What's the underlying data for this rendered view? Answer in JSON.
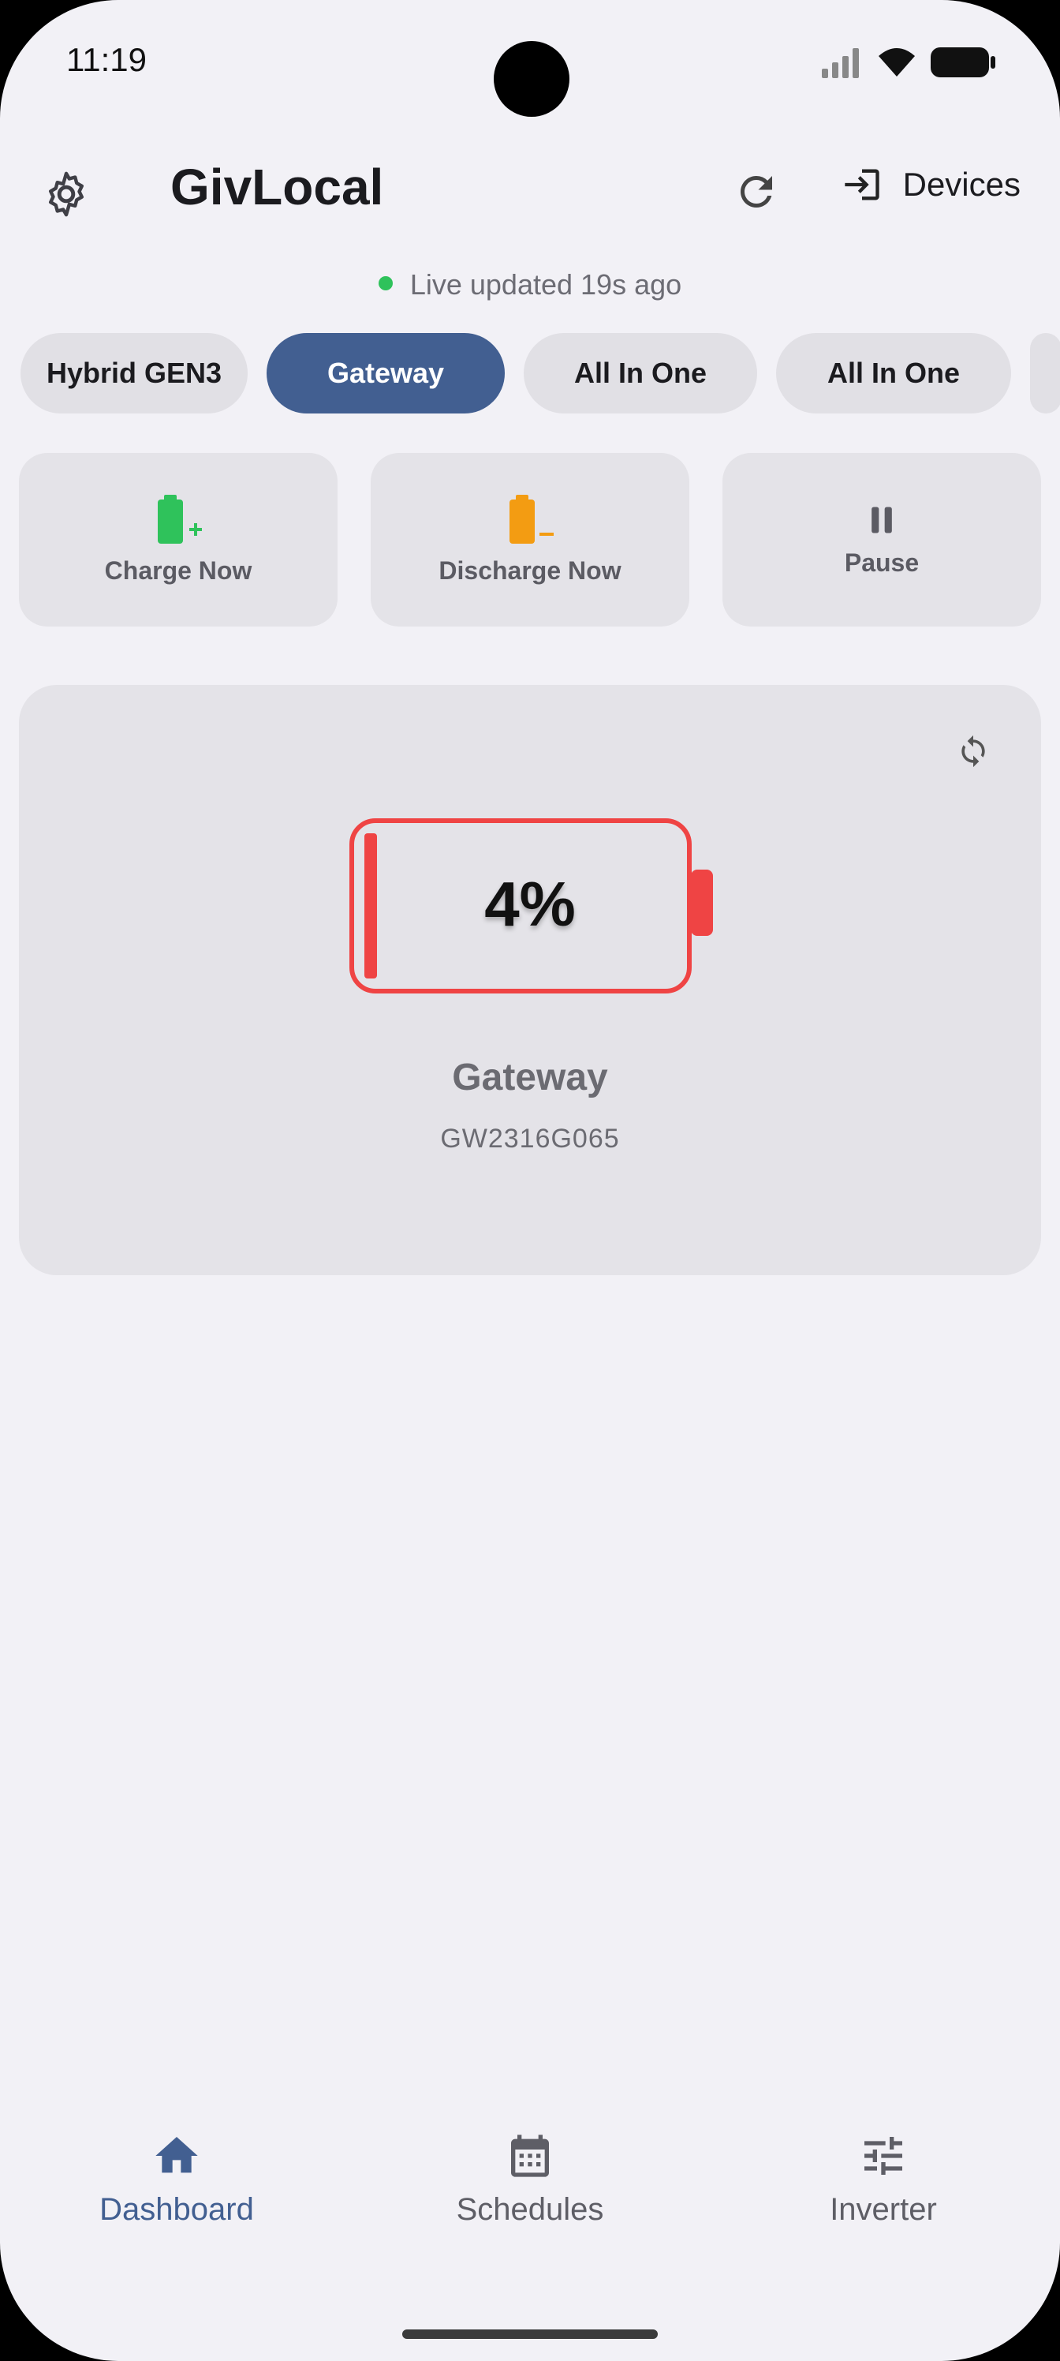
{
  "status": {
    "time": "11:19"
  },
  "header": {
    "title": "GivLocal",
    "devices_label": "Devices"
  },
  "live": {
    "text": "Live updated 19s ago"
  },
  "chips": [
    {
      "label": "Hybrid GEN3",
      "active": false
    },
    {
      "label": "Gateway",
      "active": true
    },
    {
      "label": "All In One",
      "active": false
    },
    {
      "label": "All In One",
      "active": false
    }
  ],
  "actions": [
    {
      "label": "Charge Now",
      "icon": "battery-charge-icon",
      "color": "#2fc25b"
    },
    {
      "label": "Discharge Now",
      "icon": "battery-discharge-icon",
      "color": "#f39c12"
    },
    {
      "label": "Pause",
      "icon": "pause-icon",
      "color": "#5b5b63"
    }
  ],
  "card": {
    "battery_percent": "4%",
    "battery_level": 0.04,
    "battery_color": "#ef4444",
    "name": "Gateway",
    "serial": "GW2316G065"
  },
  "nav": [
    {
      "label": "Dashboard",
      "icon": "home-icon",
      "active": true
    },
    {
      "label": "Schedules",
      "icon": "calendar-icon",
      "active": false
    },
    {
      "label": "Inverter",
      "icon": "tune-icon",
      "active": false
    }
  ]
}
